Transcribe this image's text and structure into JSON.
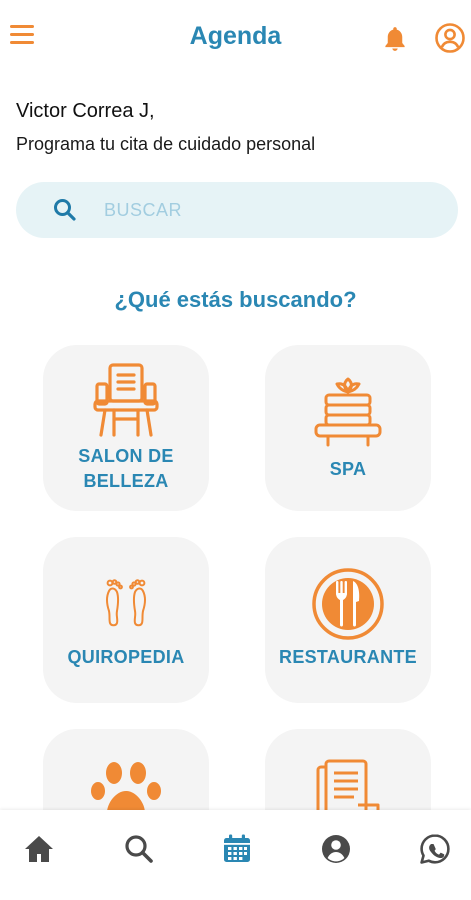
{
  "header": {
    "title": "Agenda",
    "menu_icon": "hamburger-menu-icon",
    "bell_icon": "bell-icon",
    "profile_icon": "user-circle-icon"
  },
  "greeting": {
    "name": "Victor Correa J,",
    "subtitle": "Programa tu cita de cuidado personal"
  },
  "search": {
    "placeholder": "BUSCAR",
    "icon": "search-icon"
  },
  "section": {
    "title": "¿Qué estás buscando?"
  },
  "categories": [
    {
      "label_line1": "SALON DE",
      "label_line2": "BELLEZA",
      "icon": "salon-chair-icon"
    },
    {
      "label_line1": "SPA",
      "icon": "spa-towels-icon"
    },
    {
      "label_line1": "QUIROPEDIA",
      "icon": "footprints-icon"
    },
    {
      "label_line1": "RESTAURANTE",
      "icon": "plate-cutlery-icon"
    },
    {
      "icon": "paw-icon"
    },
    {
      "icon": "documents-icon"
    }
  ],
  "bottom_nav": [
    {
      "icon": "home-icon",
      "active": false
    },
    {
      "icon": "search-icon",
      "active": false
    },
    {
      "icon": "calendar-icon",
      "active": true
    },
    {
      "icon": "user-icon",
      "active": false
    },
    {
      "icon": "whatsapp-icon",
      "active": false
    }
  ],
  "colors": {
    "accent_orange": "#f08a35",
    "primary_blue": "#2a87b3",
    "search_bg": "#e6f3f6",
    "card_bg": "#f4f4f4",
    "nav_inactive": "#4a4a4a"
  }
}
